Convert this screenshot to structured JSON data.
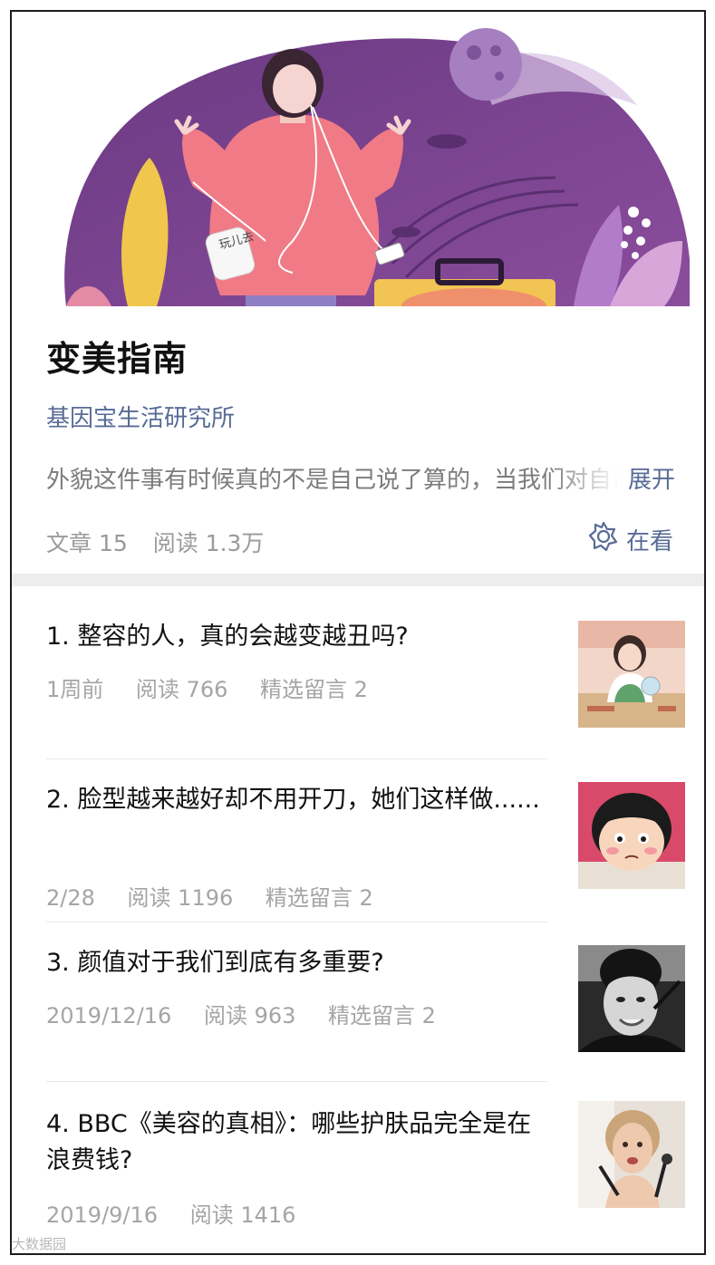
{
  "album": {
    "title": "变美指南",
    "account": "基因宝生活研究所",
    "description": "外貌这件事有时候真的不是自己说了算的，当我们对自己",
    "expand_label": "展开",
    "article_count_label": "文章 15",
    "read_count_label": "阅读 1.3万",
    "watching_label": "在看",
    "banner_bag_text": "玩儿去"
  },
  "articles": [
    {
      "title": "1. 整容的人，真的会越变越丑吗?",
      "time": "1周前",
      "reads": "阅读 766",
      "comments": "精选留言 2"
    },
    {
      "title": "2. 脸型越来越好却不用开刀，她们这样做......",
      "time": "2/28",
      "reads": "阅读 1196",
      "comments": "精选留言 2"
    },
    {
      "title": "3. 颜值对于我们到底有多重要?",
      "time": "2019/12/16",
      "reads": "阅读 963",
      "comments": "精选留言 2"
    },
    {
      "title": "4. BBC《美容的真相》：哪些护肤品完全是在浪费钱?",
      "time": "2019/9/16",
      "reads": "阅读 1416",
      "comments": ""
    }
  ],
  "watermark": "大数据园",
  "colors": {
    "link": "#576b95",
    "banner_purple": "#7b3f8c",
    "girl_sweater": "#f07a86"
  },
  "icons": {
    "watching": "star-flower-icon"
  }
}
